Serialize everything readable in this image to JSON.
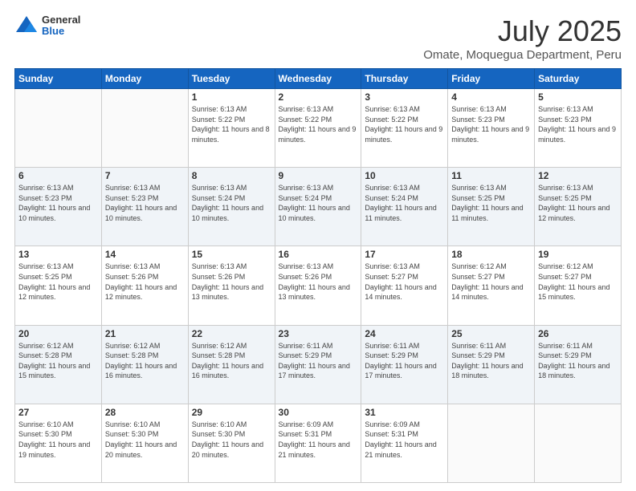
{
  "header": {
    "logo": {
      "general": "General",
      "blue": "Blue"
    },
    "title": "July 2025",
    "subtitle": "Omate, Moquegua Department, Peru"
  },
  "calendar": {
    "days_of_week": [
      "Sunday",
      "Monday",
      "Tuesday",
      "Wednesday",
      "Thursday",
      "Friday",
      "Saturday"
    ],
    "weeks": [
      [
        {
          "day": "",
          "sunrise": "",
          "sunset": "",
          "daylight": ""
        },
        {
          "day": "",
          "sunrise": "",
          "sunset": "",
          "daylight": ""
        },
        {
          "day": "1",
          "sunrise": "Sunrise: 6:13 AM",
          "sunset": "Sunset: 5:22 PM",
          "daylight": "Daylight: 11 hours and 8 minutes."
        },
        {
          "day": "2",
          "sunrise": "Sunrise: 6:13 AM",
          "sunset": "Sunset: 5:22 PM",
          "daylight": "Daylight: 11 hours and 9 minutes."
        },
        {
          "day": "3",
          "sunrise": "Sunrise: 6:13 AM",
          "sunset": "Sunset: 5:22 PM",
          "daylight": "Daylight: 11 hours and 9 minutes."
        },
        {
          "day": "4",
          "sunrise": "Sunrise: 6:13 AM",
          "sunset": "Sunset: 5:23 PM",
          "daylight": "Daylight: 11 hours and 9 minutes."
        },
        {
          "day": "5",
          "sunrise": "Sunrise: 6:13 AM",
          "sunset": "Sunset: 5:23 PM",
          "daylight": "Daylight: 11 hours and 9 minutes."
        }
      ],
      [
        {
          "day": "6",
          "sunrise": "Sunrise: 6:13 AM",
          "sunset": "Sunset: 5:23 PM",
          "daylight": "Daylight: 11 hours and 10 minutes."
        },
        {
          "day": "7",
          "sunrise": "Sunrise: 6:13 AM",
          "sunset": "Sunset: 5:23 PM",
          "daylight": "Daylight: 11 hours and 10 minutes."
        },
        {
          "day": "8",
          "sunrise": "Sunrise: 6:13 AM",
          "sunset": "Sunset: 5:24 PM",
          "daylight": "Daylight: 11 hours and 10 minutes."
        },
        {
          "day": "9",
          "sunrise": "Sunrise: 6:13 AM",
          "sunset": "Sunset: 5:24 PM",
          "daylight": "Daylight: 11 hours and 10 minutes."
        },
        {
          "day": "10",
          "sunrise": "Sunrise: 6:13 AM",
          "sunset": "Sunset: 5:24 PM",
          "daylight": "Daylight: 11 hours and 11 minutes."
        },
        {
          "day": "11",
          "sunrise": "Sunrise: 6:13 AM",
          "sunset": "Sunset: 5:25 PM",
          "daylight": "Daylight: 11 hours and 11 minutes."
        },
        {
          "day": "12",
          "sunrise": "Sunrise: 6:13 AM",
          "sunset": "Sunset: 5:25 PM",
          "daylight": "Daylight: 11 hours and 12 minutes."
        }
      ],
      [
        {
          "day": "13",
          "sunrise": "Sunrise: 6:13 AM",
          "sunset": "Sunset: 5:25 PM",
          "daylight": "Daylight: 11 hours and 12 minutes."
        },
        {
          "day": "14",
          "sunrise": "Sunrise: 6:13 AM",
          "sunset": "Sunset: 5:26 PM",
          "daylight": "Daylight: 11 hours and 12 minutes."
        },
        {
          "day": "15",
          "sunrise": "Sunrise: 6:13 AM",
          "sunset": "Sunset: 5:26 PM",
          "daylight": "Daylight: 11 hours and 13 minutes."
        },
        {
          "day": "16",
          "sunrise": "Sunrise: 6:13 AM",
          "sunset": "Sunset: 5:26 PM",
          "daylight": "Daylight: 11 hours and 13 minutes."
        },
        {
          "day": "17",
          "sunrise": "Sunrise: 6:13 AM",
          "sunset": "Sunset: 5:27 PM",
          "daylight": "Daylight: 11 hours and 14 minutes."
        },
        {
          "day": "18",
          "sunrise": "Sunrise: 6:12 AM",
          "sunset": "Sunset: 5:27 PM",
          "daylight": "Daylight: 11 hours and 14 minutes."
        },
        {
          "day": "19",
          "sunrise": "Sunrise: 6:12 AM",
          "sunset": "Sunset: 5:27 PM",
          "daylight": "Daylight: 11 hours and 15 minutes."
        }
      ],
      [
        {
          "day": "20",
          "sunrise": "Sunrise: 6:12 AM",
          "sunset": "Sunset: 5:28 PM",
          "daylight": "Daylight: 11 hours and 15 minutes."
        },
        {
          "day": "21",
          "sunrise": "Sunrise: 6:12 AM",
          "sunset": "Sunset: 5:28 PM",
          "daylight": "Daylight: 11 hours and 16 minutes."
        },
        {
          "day": "22",
          "sunrise": "Sunrise: 6:12 AM",
          "sunset": "Sunset: 5:28 PM",
          "daylight": "Daylight: 11 hours and 16 minutes."
        },
        {
          "day": "23",
          "sunrise": "Sunrise: 6:11 AM",
          "sunset": "Sunset: 5:29 PM",
          "daylight": "Daylight: 11 hours and 17 minutes."
        },
        {
          "day": "24",
          "sunrise": "Sunrise: 6:11 AM",
          "sunset": "Sunset: 5:29 PM",
          "daylight": "Daylight: 11 hours and 17 minutes."
        },
        {
          "day": "25",
          "sunrise": "Sunrise: 6:11 AM",
          "sunset": "Sunset: 5:29 PM",
          "daylight": "Daylight: 11 hours and 18 minutes."
        },
        {
          "day": "26",
          "sunrise": "Sunrise: 6:11 AM",
          "sunset": "Sunset: 5:29 PM",
          "daylight": "Daylight: 11 hours and 18 minutes."
        }
      ],
      [
        {
          "day": "27",
          "sunrise": "Sunrise: 6:10 AM",
          "sunset": "Sunset: 5:30 PM",
          "daylight": "Daylight: 11 hours and 19 minutes."
        },
        {
          "day": "28",
          "sunrise": "Sunrise: 6:10 AM",
          "sunset": "Sunset: 5:30 PM",
          "daylight": "Daylight: 11 hours and 20 minutes."
        },
        {
          "day": "29",
          "sunrise": "Sunrise: 6:10 AM",
          "sunset": "Sunset: 5:30 PM",
          "daylight": "Daylight: 11 hours and 20 minutes."
        },
        {
          "day": "30",
          "sunrise": "Sunrise: 6:09 AM",
          "sunset": "Sunset: 5:31 PM",
          "daylight": "Daylight: 11 hours and 21 minutes."
        },
        {
          "day": "31",
          "sunrise": "Sunrise: 6:09 AM",
          "sunset": "Sunset: 5:31 PM",
          "daylight": "Daylight: 11 hours and 21 minutes."
        },
        {
          "day": "",
          "sunrise": "",
          "sunset": "",
          "daylight": ""
        },
        {
          "day": "",
          "sunrise": "",
          "sunset": "",
          "daylight": ""
        }
      ]
    ]
  }
}
